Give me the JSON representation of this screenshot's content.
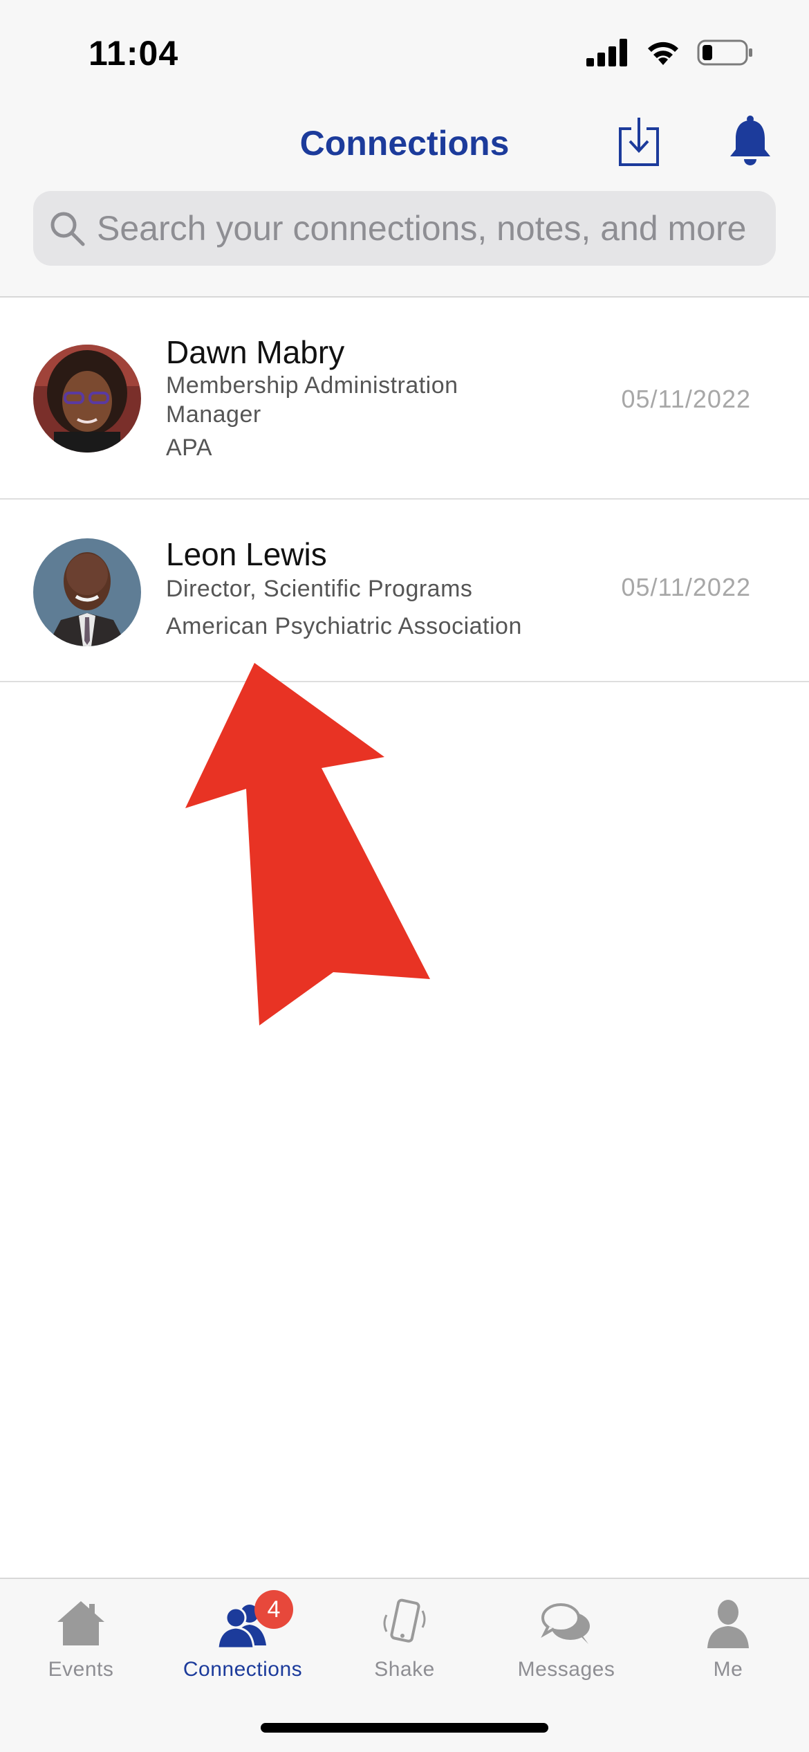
{
  "status_bar": {
    "time": "11:04"
  },
  "nav": {
    "title": "Connections"
  },
  "search": {
    "placeholder": "Search your connections, notes, and more"
  },
  "connections": [
    {
      "name": "Dawn Mabry",
      "title_line_1": "Membership Administration",
      "title_line_2": "Manager",
      "organization": "APA",
      "date": "05/11/2022"
    },
    {
      "name": "Leon Lewis",
      "title_line_1": "Director, Scientific Programs",
      "organization": "American Psychiatric Association",
      "date": "05/11/2022"
    }
  ],
  "tabbar": {
    "tabs": [
      {
        "label": "Events",
        "icon": "home-icon"
      },
      {
        "label": "Connections",
        "icon": "people-icon",
        "active": true,
        "badge": "4"
      },
      {
        "label": "Shake",
        "icon": "phone-shake-icon"
      },
      {
        "label": "Messages",
        "icon": "chat-bubbles-icon"
      },
      {
        "label": "Me",
        "icon": "person-icon"
      }
    ]
  },
  "colors": {
    "brand": "#1c3b9b",
    "badge": "#e7483b",
    "annotation_arrow": "#e83324"
  }
}
